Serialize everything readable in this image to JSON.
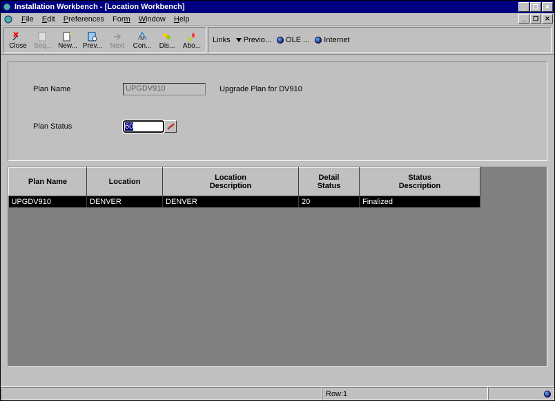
{
  "window": {
    "title": "Installation Workbench - [Location Workbench]"
  },
  "menu": {
    "file": "File",
    "edit": "Edit",
    "preferences": "Preferences",
    "form": "Form",
    "window": "Window",
    "help": "Help"
  },
  "toolbar": {
    "close": "Close",
    "seq": "Seq...",
    "new": "New...",
    "prev": "Prev...",
    "next": "Next",
    "con": "Con...",
    "dis": "Dis...",
    "abo": "Abo..."
  },
  "links": {
    "label": "Links",
    "previo": "Previo...",
    "ole": "OLE ...",
    "internet": "Internet"
  },
  "form": {
    "plan_name_label": "Plan Name",
    "plan_name_value": "UPGDV910",
    "plan_desc": "Upgrade Plan for DV910",
    "plan_status_label": "Plan Status",
    "plan_status_value": "60"
  },
  "grid": {
    "headers": {
      "plan_name": "Plan Name",
      "location": "Location",
      "location_desc": "Location\nDescription",
      "detail_status": "Detail\nStatus",
      "status_desc": "Status\nDescription"
    },
    "rows": [
      {
        "plan_name": "UPGDV910",
        "location": "DENVER",
        "location_desc": "DENVER",
        "detail_status": "20",
        "status_desc": "Finalized"
      }
    ]
  },
  "statusbar": {
    "row": "Row:1"
  }
}
